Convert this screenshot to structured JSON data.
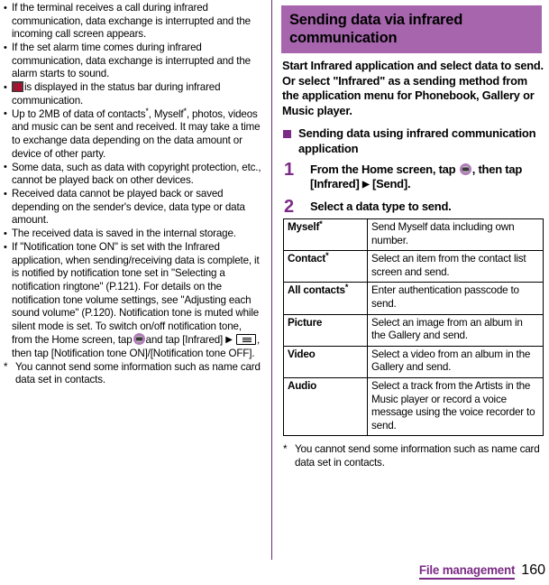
{
  "left_column": {
    "bullets": [
      "If the terminal receives a call during infrared communication, data exchange is interrupted and the incoming call screen appears.",
      "If the set alarm time comes during infrared communication, data exchange is interrupted and the alarm starts to sound.",
      "is displayed in the status bar during infrared communication.",
      "Up to 2MB of data of contacts*, Myself*, photos, videos and music can be sent and received. It may take a time to exchange data depending on the data amount or device of other party.",
      "Some data, such as data with copyright protection, etc., cannot be played back on other devices.",
      "Received data cannot be played back or saved depending on the sender's device, data type or data amount.",
      "The received data is saved in the internal storage.",
      "If \"Notification tone ON\" is set with the Infrared application, when sending/receiving data is complete, it is notified by notification tone set in \"Selecting a notification ringtone\" (P.121). For details on the notification tone volume settings, see \"Adjusting each sound volume\" (P.120). Notification tone is muted while silent mode is set. To switch on/off notification tone, from the Home screen, tap"
    ],
    "bullet3_icon": "infrared-status-icon",
    "bullet4_pre": "Up to 2MB of data of contacts",
    "bullet4_mid": ", Myself",
    "bullet4_post": ", photos, videos and music can be sent and received. It may take a time to exchange data depending on the data amount or device of other party.",
    "bullet8_part2": "and tap [Infrared]",
    "bullet8_part3": ", then tap [Notification tone ON]/[Notification tone OFF].",
    "footnote_marker": "*",
    "footnote_text": "You cannot send some information such as name card data set in contacts."
  },
  "right_column": {
    "banner_title": "Sending data via infrared communication",
    "intro": "Start Infrared application and select data to send. Or select \"Infrared\" as a sending method from the application menu for Phonebook, Gallery or Music player.",
    "subheading": "Sending data using infrared communication application",
    "steps": [
      {
        "number": "1",
        "text_part1": "From the Home screen, tap",
        "text_part2": ", then tap [Infrared]",
        "text_part3": "[Send]."
      },
      {
        "number": "2",
        "text_part1": "Select a data type to send.",
        "text_part2": "",
        "text_part3": ""
      }
    ],
    "table": {
      "rows": [
        {
          "type": "Myself",
          "asterisk": "*",
          "description": "Send Myself data including own number."
        },
        {
          "type": "Contact",
          "asterisk": "*",
          "description": "Select an item from the contact list screen and send."
        },
        {
          "type": "All contacts",
          "asterisk": "*",
          "description": "Enter authentication passcode to send."
        },
        {
          "type": "Picture",
          "asterisk": "",
          "description": "Select an image from an album in the Gallery and send."
        },
        {
          "type": "Video",
          "asterisk": "",
          "description": "Select a video from an album in the Gallery and send."
        },
        {
          "type": "Audio",
          "asterisk": "",
          "description": "Select a track from the Artists in the Music player or record a voice message using the voice recorder to send."
        }
      ]
    },
    "footnote_marker": "*",
    "footnote_text": "You cannot send some information such as name card data set in contacts."
  },
  "footer": {
    "chapter": "File management",
    "page_number": "160"
  },
  "colors": {
    "banner_bg": "#a665ad",
    "accent_purple": "#7b2b86",
    "divider": "#6b2a73",
    "infrared_red": "#d9002b"
  }
}
